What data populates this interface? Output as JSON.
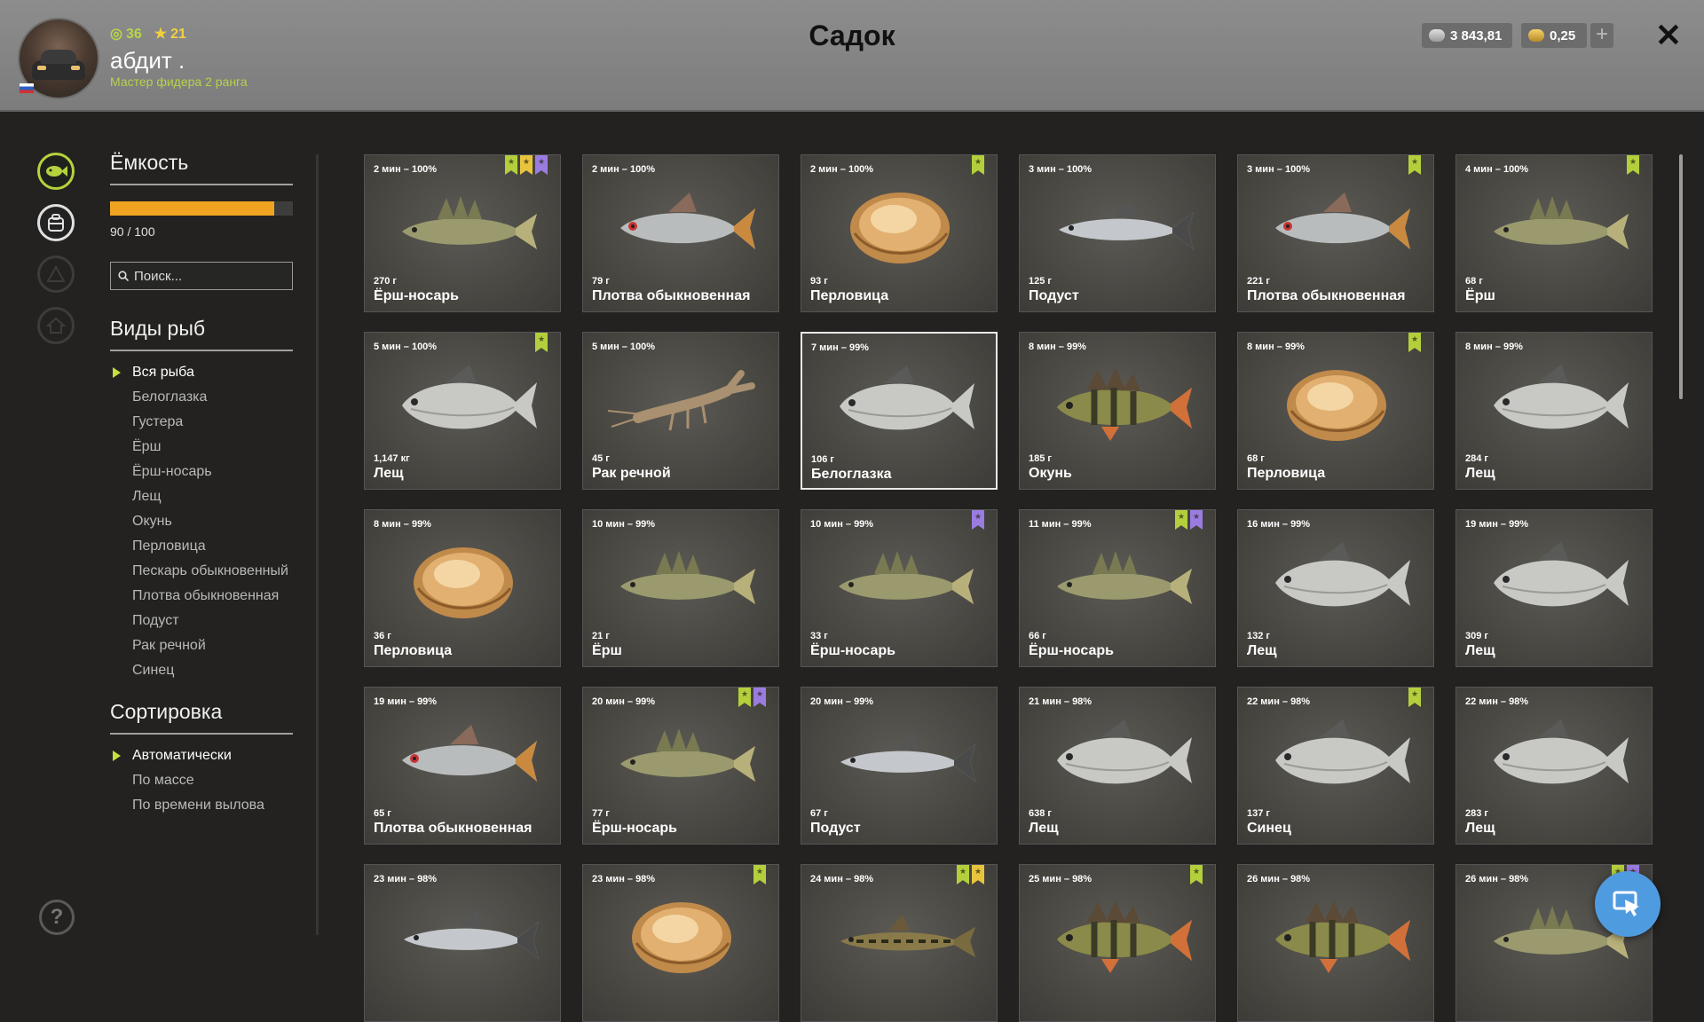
{
  "header": {
    "title": "Садок",
    "level": "36",
    "stars": "21",
    "username": "абдит .",
    "rank": "Мастер фидера 2 ранга",
    "silver": "3 843,81",
    "gold": "0,25",
    "plus_label": "+",
    "close_label": "✕"
  },
  "panel": {
    "capacity_title": "Ёмкость",
    "capacity_text": "90 / 100",
    "capacity_fraction": 0.9,
    "search_placeholder": "Поиск...",
    "species_title": "Виды рыб",
    "species": [
      "Вся рыба",
      "Белоглазка",
      "Густера",
      "Ёрш",
      "Ёрш-носарь",
      "Лещ",
      "Окунь",
      "Перловица",
      "Пескарь обыкновенный",
      "Плотва обыкновенная",
      "Подуст",
      "Рак речной",
      "Синец"
    ],
    "selected_species_index": 0,
    "sort_title": "Сортировка",
    "sort_options": [
      "Автоматически",
      "По массе",
      "По времени вылова"
    ],
    "selected_sort_index": 0
  },
  "help_label": "?",
  "colors": {
    "accent_green": "#b6d23c",
    "capacity_orange": "#f0a321",
    "badge_green": "#b4cf3c",
    "badge_gold": "#e8c43c",
    "badge_purple": "#9a7ce0",
    "fab_blue": "#4f9be0"
  },
  "catches": [
    {
      "time": "2 мин – 100%",
      "weight": "270 г",
      "name": "Ёрш-носарь",
      "kind": "ruffe",
      "badges": [
        "green",
        "gold",
        "purple"
      ]
    },
    {
      "time": "2 мин – 100%",
      "weight": "79 г",
      "name": "Плотва обыкновенная",
      "kind": "roach",
      "badges": []
    },
    {
      "time": "2 мин – 100%",
      "weight": "93 г",
      "name": "Перловица",
      "kind": "mussel",
      "badges": [
        "green"
      ]
    },
    {
      "time": "3 мин – 100%",
      "weight": "125 г",
      "name": "Подуст",
      "kind": "nase",
      "badges": []
    },
    {
      "time": "3 мин – 100%",
      "weight": "221 г",
      "name": "Плотва обыкновенная",
      "kind": "roach",
      "badges": [
        "green"
      ]
    },
    {
      "time": "4 мин – 100%",
      "weight": "68 г",
      "name": "Ёрш",
      "kind": "ruffe",
      "badges": [
        "green"
      ]
    },
    {
      "time": "5 мин – 100%",
      "weight": "1,147 кг",
      "name": "Лещ",
      "kind": "bream",
      "badges": [
        "green"
      ]
    },
    {
      "time": "5 мин – 100%",
      "weight": "45 г",
      "name": "Рак речной",
      "kind": "crayfish",
      "badges": []
    },
    {
      "time": "7 мин – 99%",
      "weight": "106 г",
      "name": "Белоглазка",
      "kind": "bream",
      "badges": [],
      "selected": true
    },
    {
      "time": "8 мин – 99%",
      "weight": "185 г",
      "name": "Окунь",
      "kind": "perch",
      "badges": []
    },
    {
      "time": "8 мин – 99%",
      "weight": "68 г",
      "name": "Перловица",
      "kind": "mussel",
      "badges": [
        "green"
      ]
    },
    {
      "time": "8 мин – 99%",
      "weight": "284 г",
      "name": "Лещ",
      "kind": "bream",
      "badges": []
    },
    {
      "time": "8 мин – 99%",
      "weight": "36 г",
      "name": "Перловица",
      "kind": "mussel",
      "badges": []
    },
    {
      "time": "10 мин – 99%",
      "weight": "21 г",
      "name": "Ёрш",
      "kind": "ruffe",
      "badges": []
    },
    {
      "time": "10 мин – 99%",
      "weight": "33 г",
      "name": "Ёрш-носарь",
      "kind": "ruffe",
      "badges": [
        "purple"
      ]
    },
    {
      "time": "11 мин – 99%",
      "weight": "66 г",
      "name": "Ёрш-носарь",
      "kind": "ruffe",
      "badges": [
        "green",
        "purple"
      ]
    },
    {
      "time": "16 мин – 99%",
      "weight": "132 г",
      "name": "Лещ",
      "kind": "bream",
      "badges": []
    },
    {
      "time": "19 мин – 99%",
      "weight": "309 г",
      "name": "Лещ",
      "kind": "bream",
      "badges": []
    },
    {
      "time": "19 мин – 99%",
      "weight": "65 г",
      "name": "Плотва обыкновенная",
      "kind": "roach",
      "badges": []
    },
    {
      "time": "20 мин – 99%",
      "weight": "77 г",
      "name": "Ёрш-носарь",
      "kind": "ruffe",
      "badges": [
        "green",
        "purple"
      ]
    },
    {
      "time": "20 мин – 99%",
      "weight": "67 г",
      "name": "Подуст",
      "kind": "nase",
      "badges": []
    },
    {
      "time": "21 мин – 98%",
      "weight": "638 г",
      "name": "Лещ",
      "kind": "bream",
      "badges": []
    },
    {
      "time": "22 мин – 98%",
      "weight": "137 г",
      "name": "Синец",
      "kind": "bream",
      "badges": [
        "green"
      ]
    },
    {
      "time": "22 мин – 98%",
      "weight": "283 г",
      "name": "Лещ",
      "kind": "bream",
      "badges": []
    },
    {
      "time": "23 мин – 98%",
      "weight": "",
      "name": "",
      "kind": "nase",
      "badges": []
    },
    {
      "time": "23 мин – 98%",
      "weight": "",
      "name": "",
      "kind": "mussel",
      "badges": [
        "green"
      ]
    },
    {
      "time": "24 мин – 98%",
      "weight": "",
      "name": "",
      "kind": "gudgeon",
      "badges": [
        "green",
        "gold"
      ]
    },
    {
      "time": "25 мин – 98%",
      "weight": "",
      "name": "",
      "kind": "perch",
      "badges": [
        "green"
      ]
    },
    {
      "time": "26 мин – 98%",
      "weight": "",
      "name": "",
      "kind": "perch",
      "badges": []
    },
    {
      "time": "26 мин – 98%",
      "weight": "",
      "name": "",
      "kind": "ruffe",
      "badges": [
        "green",
        "purple"
      ]
    }
  ]
}
